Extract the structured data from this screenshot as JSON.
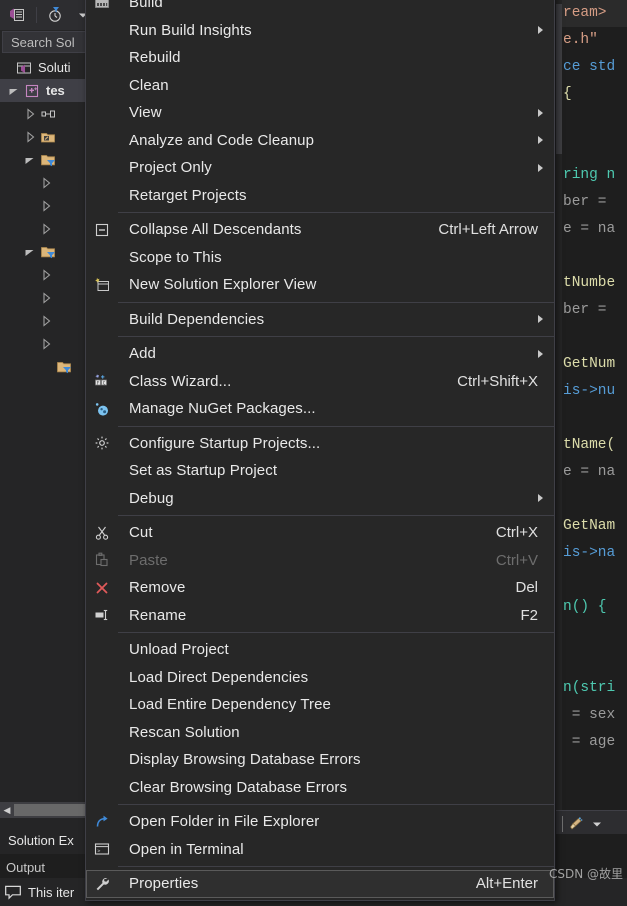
{
  "solution_explorer": {
    "toolbar_icons": [
      "solution-view-icon",
      "pending-changes-filter-icon",
      "history-icon",
      "dropdown-caret-icon"
    ],
    "search": {
      "placeholder": "Search Sol",
      "value": "Search Sol"
    },
    "tree": [
      {
        "label": "Soluti",
        "icon": "solution-icon",
        "twisty": "none",
        "indent": 1,
        "bold": false,
        "selected": false
      },
      {
        "label": "tes",
        "icon": "cpp-project-icon",
        "twisty": "expanded",
        "indent": 0,
        "bold": true,
        "selected": true
      },
      {
        "label": "",
        "icon": "references-icon",
        "twisty": "collapsed",
        "indent": 2,
        "bold": false,
        "selected": false
      },
      {
        "label": "",
        "icon": "external-dependencies-icon",
        "twisty": "collapsed",
        "indent": 2,
        "bold": false,
        "selected": false
      },
      {
        "label": "",
        "icon": "filter-folder-icon",
        "twisty": "expanded",
        "indent": 2,
        "bold": false,
        "selected": false
      },
      {
        "label": "",
        "icon": "none",
        "twisty": "collapsed",
        "indent": 3,
        "bold": false,
        "selected": false
      },
      {
        "label": "",
        "icon": "none",
        "twisty": "collapsed",
        "indent": 3,
        "bold": false,
        "selected": false
      },
      {
        "label": "",
        "icon": "none",
        "twisty": "collapsed",
        "indent": 3,
        "bold": false,
        "selected": false
      },
      {
        "label": "",
        "icon": "filter-folder-icon",
        "twisty": "expanded",
        "indent": 2,
        "bold": false,
        "selected": false
      },
      {
        "label": "",
        "icon": "none",
        "twisty": "collapsed",
        "indent": 3,
        "bold": false,
        "selected": false
      },
      {
        "label": "",
        "icon": "none",
        "twisty": "collapsed",
        "indent": 3,
        "bold": false,
        "selected": false
      },
      {
        "label": "",
        "icon": "none",
        "twisty": "collapsed",
        "indent": 3,
        "bold": false,
        "selected": false
      },
      {
        "label": "",
        "icon": "none",
        "twisty": "collapsed",
        "indent": 3,
        "bold": false,
        "selected": false
      },
      {
        "label": "",
        "icon": "filter-folder-icon",
        "twisty": "none",
        "indent": 3,
        "bold": false,
        "selected": false
      }
    ],
    "tabs": [
      "Solution Ex"
    ],
    "output_tab": "Output"
  },
  "statusbar": {
    "message": "This iter",
    "icon": "message-icon"
  },
  "context_menu": {
    "selected_item": "Properties",
    "items": [
      {
        "label": "Build",
        "icon": "build-icon",
        "accel": "",
        "submenu": false,
        "disabled": false,
        "separator_after": false
      },
      {
        "label": "Run Build Insights",
        "icon": "none",
        "accel": "",
        "submenu": true,
        "disabled": false,
        "separator_after": false
      },
      {
        "label": "Rebuild",
        "icon": "none",
        "accel": "",
        "submenu": false,
        "disabled": false,
        "separator_after": false
      },
      {
        "label": "Clean",
        "icon": "none",
        "accel": "",
        "submenu": false,
        "disabled": false,
        "separator_after": false
      },
      {
        "label": "View",
        "icon": "none",
        "accel": "",
        "submenu": true,
        "disabled": false,
        "separator_after": false
      },
      {
        "label": "Analyze and Code Cleanup",
        "icon": "none",
        "accel": "",
        "submenu": true,
        "disabled": false,
        "separator_after": false
      },
      {
        "label": "Project Only",
        "icon": "none",
        "accel": "",
        "submenu": true,
        "disabled": false,
        "separator_after": false
      },
      {
        "label": "Retarget Projects",
        "icon": "none",
        "accel": "",
        "submenu": false,
        "disabled": false,
        "separator_after": true
      },
      {
        "label": "Collapse All Descendants",
        "icon": "collapse-icon",
        "accel": "Ctrl+Left Arrow",
        "submenu": false,
        "disabled": false,
        "separator_after": false
      },
      {
        "label": "Scope to This",
        "icon": "none",
        "accel": "",
        "submenu": false,
        "disabled": false,
        "separator_after": false
      },
      {
        "label": "New Solution Explorer View",
        "icon": "new-solution-explorer-view-icon",
        "accel": "",
        "submenu": false,
        "disabled": false,
        "separator_after": true
      },
      {
        "label": "Build Dependencies",
        "icon": "none",
        "accel": "",
        "submenu": true,
        "disabled": false,
        "separator_after": true
      },
      {
        "label": "Add",
        "icon": "none",
        "accel": "",
        "submenu": true,
        "disabled": false,
        "separator_after": false
      },
      {
        "label": "Class Wizard...",
        "icon": "class-wizard-icon",
        "accel": "Ctrl+Shift+X",
        "submenu": false,
        "disabled": false,
        "separator_after": false
      },
      {
        "label": "Manage NuGet Packages...",
        "icon": "nuget-icon",
        "accel": "",
        "submenu": false,
        "disabled": false,
        "separator_after": true
      },
      {
        "label": "Configure Startup Projects...",
        "icon": "gear-icon",
        "accel": "",
        "submenu": false,
        "disabled": false,
        "separator_after": false
      },
      {
        "label": "Set as Startup Project",
        "icon": "none",
        "accel": "",
        "submenu": false,
        "disabled": false,
        "separator_after": false
      },
      {
        "label": "Debug",
        "icon": "none",
        "accel": "",
        "submenu": true,
        "disabled": false,
        "separator_after": true
      },
      {
        "label": "Cut",
        "icon": "cut-icon",
        "accel": "Ctrl+X",
        "submenu": false,
        "disabled": false,
        "separator_after": false
      },
      {
        "label": "Paste",
        "icon": "paste-icon",
        "accel": "Ctrl+V",
        "submenu": false,
        "disabled": true,
        "separator_after": false
      },
      {
        "label": "Remove",
        "icon": "remove-icon",
        "accel": "Del",
        "submenu": false,
        "disabled": false,
        "separator_after": false
      },
      {
        "label": "Rename",
        "icon": "rename-icon",
        "accel": "F2",
        "submenu": false,
        "disabled": false,
        "separator_after": true
      },
      {
        "label": "Unload Project",
        "icon": "none",
        "accel": "",
        "submenu": false,
        "disabled": false,
        "separator_after": false
      },
      {
        "label": "Load Direct Dependencies",
        "icon": "none",
        "accel": "",
        "submenu": false,
        "disabled": false,
        "separator_after": false
      },
      {
        "label": "Load Entire Dependency Tree",
        "icon": "none",
        "accel": "",
        "submenu": false,
        "disabled": false,
        "separator_after": false
      },
      {
        "label": "Rescan Solution",
        "icon": "none",
        "accel": "",
        "submenu": false,
        "disabled": false,
        "separator_after": false
      },
      {
        "label": "Display Browsing Database Errors",
        "icon": "none",
        "accel": "",
        "submenu": false,
        "disabled": false,
        "separator_after": false
      },
      {
        "label": "Clear Browsing Database Errors",
        "icon": "none",
        "accel": "",
        "submenu": false,
        "disabled": false,
        "separator_after": true
      },
      {
        "label": "Open Folder in File Explorer",
        "icon": "open-folder-icon",
        "accel": "",
        "submenu": false,
        "disabled": false,
        "separator_after": false
      },
      {
        "label": "Open in Terminal",
        "icon": "terminal-icon",
        "accel": "",
        "submenu": false,
        "disabled": false,
        "separator_after": true
      },
      {
        "label": "Properties",
        "icon": "wrench-icon",
        "accel": "Alt+Enter",
        "submenu": false,
        "disabled": false,
        "separator_after": false
      }
    ]
  },
  "editor": {
    "lines": [
      {
        "text": "ream>",
        "color": "orange",
        "highlight": true
      },
      {
        "text": "e.h\"",
        "color": "orange",
        "highlight": false
      },
      {
        "text": "ce std",
        "color": "blue",
        "highlight": false
      },
      {
        "text": "{",
        "color": "yellow",
        "highlight": false
      },
      {
        "text": "",
        "color": "white",
        "highlight": false
      },
      {
        "text": "",
        "color": "white",
        "highlight": false
      },
      {
        "text": "ring n",
        "color": "green",
        "highlight": false
      },
      {
        "text": "ber = ",
        "color": "gray",
        "highlight": false
      },
      {
        "text": "e = na",
        "color": "gray",
        "highlight": false
      },
      {
        "text": "",
        "color": "white",
        "highlight": false
      },
      {
        "text": "tNumbe",
        "color": "yellow",
        "highlight": false
      },
      {
        "text": "ber = ",
        "color": "gray",
        "highlight": false
      },
      {
        "text": "",
        "color": "white",
        "highlight": false
      },
      {
        "text": "GetNum",
        "color": "yellow",
        "highlight": false
      },
      {
        "text": "is->nu",
        "color": "blue",
        "highlight": false
      },
      {
        "text": "",
        "color": "white",
        "highlight": false
      },
      {
        "text": "tName(",
        "color": "yellow",
        "highlight": false
      },
      {
        "text": "e = na",
        "color": "gray",
        "highlight": false
      },
      {
        "text": "",
        "color": "white",
        "highlight": false
      },
      {
        "text": "GetNam",
        "color": "yellow",
        "highlight": false
      },
      {
        "text": "is->na",
        "color": "blue",
        "highlight": false
      },
      {
        "text": "",
        "color": "white",
        "highlight": false
      },
      {
        "text": "n() {",
        "color": "green",
        "highlight": false
      },
      {
        "text": "",
        "color": "white",
        "highlight": false
      },
      {
        "text": "",
        "color": "white",
        "highlight": false
      },
      {
        "text": "n(stri",
        "color": "green",
        "highlight": false
      },
      {
        "text": " = sex",
        "color": "gray",
        "highlight": false
      },
      {
        "text": " = age",
        "color": "gray",
        "highlight": false
      }
    ],
    "toolbar_icons": [
      "broom-icon",
      "dropdown-caret-icon"
    ]
  },
  "watermark": "CSDN @故里",
  "colors": {
    "menu_bg": "#272727",
    "menu_border": "#3f3f46",
    "menu_text": "#e9e9e9",
    "menu_disabled": "#6d6d6d",
    "editor_bg": "#1e1e1e",
    "accent_blue": "#3f8ad9",
    "remove_red": "#e05a5a",
    "folder_gold": "#dcb67a"
  }
}
